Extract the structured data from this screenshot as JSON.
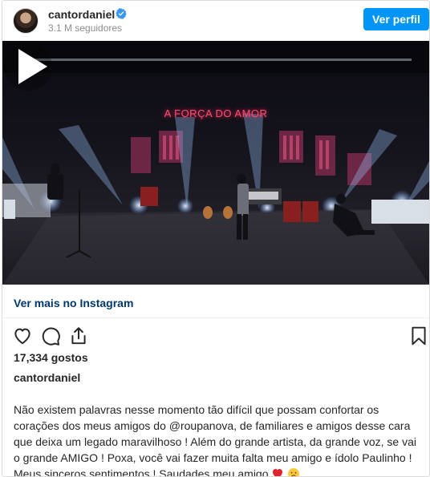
{
  "header": {
    "username": "cantordaniel",
    "followers": "3.1 M seguidores",
    "view_profile_label": "Ver perfil"
  },
  "video": {
    "overlay_text": "A FORÇA DO AMOR"
  },
  "post": {
    "more_link": "Ver mais no Instagram",
    "likes": "17,334 gostos",
    "caption_user": "cantordaniel",
    "caption_text": "Não existem palavras nesse momento tão difícil que possam confortar os corações dos meus amigos do @roupanova, de familiares e amigos desse cara que deixa um legado maravilhoso ! Além do grande artista, da grande voz, se vai o grande AMIGO ! Poxa, você vai fazer muita falta meu amigo e ídolo Paulinho ! Meus sinceros sentimentos ! Saudades meu amigo"
  },
  "icons": {
    "verified": "verified-badge-icon",
    "play": "play-icon",
    "like": "heart-icon",
    "comment": "comment-icon",
    "share": "share-icon",
    "save": "bookmark-icon",
    "emoji1": "red-heart-emoji",
    "emoji2": "sad-face-emoji"
  },
  "colors": {
    "primary_button": "#0095f6",
    "link": "#00376b",
    "secondary_text": "#8e8e8e",
    "neon_sign": "#ff4d76"
  }
}
